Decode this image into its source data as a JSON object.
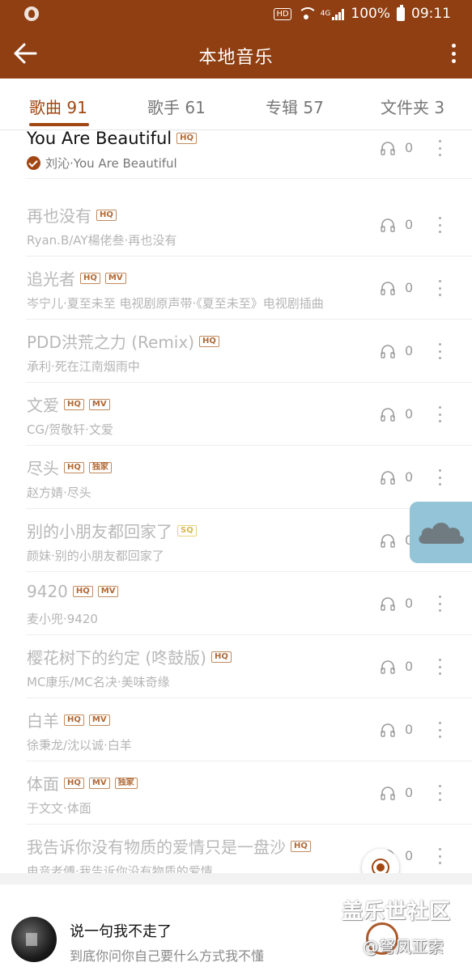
{
  "status_bar": {
    "hd_label": "HD",
    "network_label": "4G",
    "battery": "100%",
    "time": "09:11"
  },
  "appbar": {
    "title": "本地音乐"
  },
  "tabs": [
    {
      "label": "歌曲 91",
      "active": true
    },
    {
      "label": "歌手 61",
      "active": false
    },
    {
      "label": "专辑 57",
      "active": false
    },
    {
      "label": "文件夹 3",
      "active": false
    }
  ],
  "songs": [
    {
      "title": "You Are Beautiful",
      "tags": [
        "HQ"
      ],
      "subtitle": "刘沁·You Are Beautiful",
      "plays": "0",
      "playing": true
    },
    {
      "title": "再也没有",
      "tags": [
        "HQ"
      ],
      "subtitle": "Ryan.B/AY楊佬叁·再也没有",
      "plays": "0"
    },
    {
      "title": "追光者",
      "tags": [
        "HQ",
        "MV"
      ],
      "subtitle": "岑宁儿·夏至未至 电视剧原声带·《夏至未至》电视剧插曲",
      "plays": "0"
    },
    {
      "title": "PDD洪荒之力 (Remix)",
      "tags": [
        "HQ"
      ],
      "subtitle": "承利·死在江南烟雨中",
      "plays": "0"
    },
    {
      "title": "文爱",
      "tags": [
        "HQ",
        "MV"
      ],
      "subtitle": "CG/贺敬轩·文爱",
      "plays": "0"
    },
    {
      "title": "尽头",
      "tags": [
        "HQ",
        "独家"
      ],
      "subtitle": "赵方婧·尽头",
      "plays": "0"
    },
    {
      "title": "别的小朋友都回家了",
      "tags": [
        "SQ"
      ],
      "subtitle": "颜妹·别的小朋友都回家了",
      "plays": "0"
    },
    {
      "title": "9420",
      "tags": [
        "HQ",
        "MV"
      ],
      "subtitle": "麦小兜·9420",
      "plays": "0"
    },
    {
      "title": "樱花树下的约定 (咚鼓版)",
      "tags": [
        "HQ"
      ],
      "subtitle": "MC康乐/MC名决·美味奇缘",
      "plays": "0"
    },
    {
      "title": "白羊",
      "tags": [
        "HQ",
        "MV"
      ],
      "subtitle": "徐秉龙/沈以诚·白羊",
      "plays": "0"
    },
    {
      "title": "体面",
      "tags": [
        "HQ",
        "MV",
        "独家"
      ],
      "subtitle": "于文文·体面",
      "plays": "0"
    },
    {
      "title": "我告诉你没有物质的爱情只是一盘沙",
      "tags": [
        "HQ"
      ],
      "subtitle": "电音老傅·我告诉你没有物质的爱情",
      "plays": "0"
    }
  ],
  "player": {
    "title": "说一句我不走了",
    "subtitle": "到底你问你自己要什么方式我不懂"
  },
  "watermark": {
    "line1": "盖乐世社区",
    "line2": "@弩凤亚索"
  },
  "colors": {
    "header": "#8f3f12",
    "accent": "#a24713",
    "weather_widget": "#93c4d8"
  },
  "icons": {
    "back": "back-arrow-icon",
    "more": "more-vert-icon",
    "headphone": "headphone-icon",
    "playing": "check-icon",
    "weather": "cloud-icon",
    "locate": "locate-icon"
  }
}
